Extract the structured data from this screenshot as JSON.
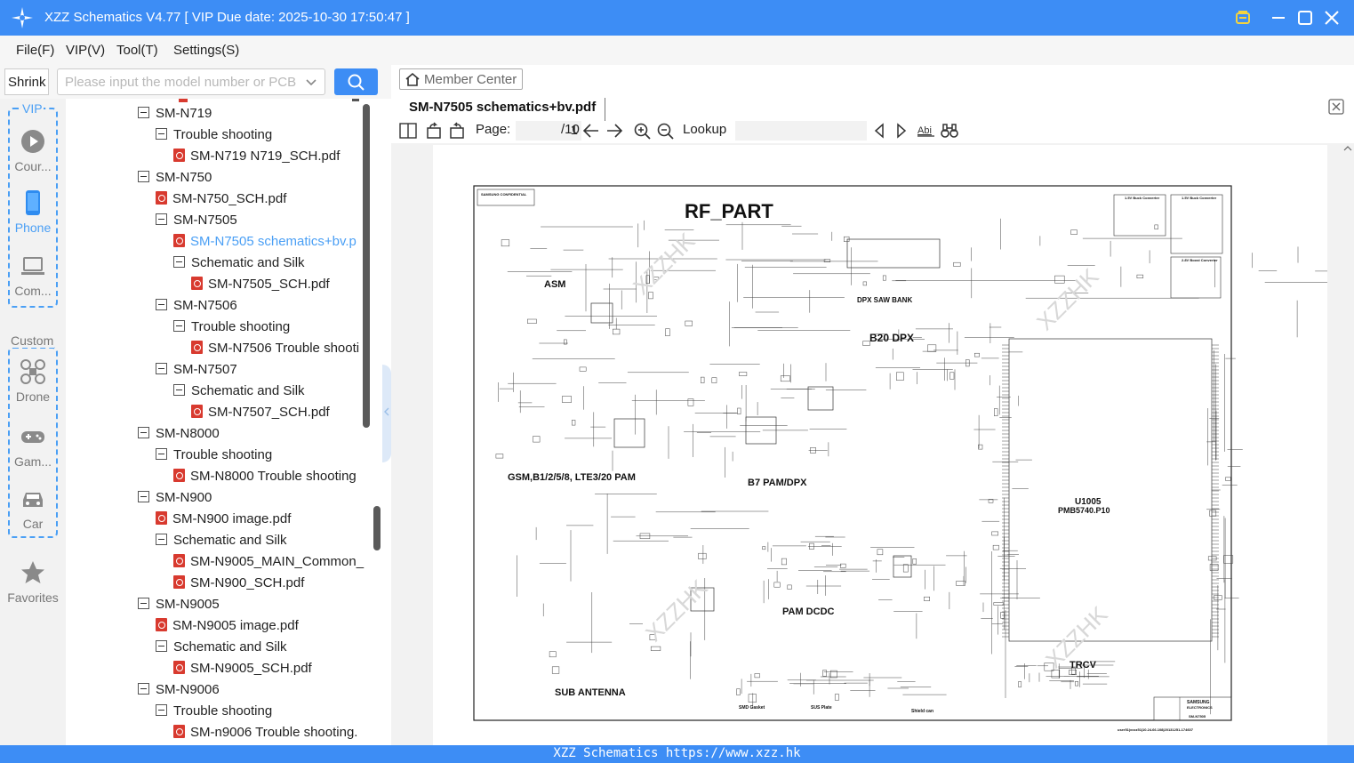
{
  "window": {
    "title": "XZZ Schematics V4.77 [ VIP Due date: 2025-10-30 17:50:47 ]"
  },
  "menu": {
    "file": "File(F)",
    "vip": "VIP(V)",
    "tool": "Tool(T)",
    "settings": "Settings(S)"
  },
  "search": {
    "shrink_label": "Shrink",
    "placeholder": "Please input the model number or PCB"
  },
  "sidebar": {
    "vip_label": "VIP",
    "custom_label": "Custom",
    "favorites_label": "Favorites",
    "items": [
      {
        "label": "Cour...",
        "icon": "play-circle-icon"
      },
      {
        "label": "Phone",
        "icon": "phone-icon",
        "active": true
      },
      {
        "label": "Com...",
        "icon": "laptop-icon"
      },
      {
        "label": "Drone",
        "icon": "drone-icon"
      },
      {
        "label": "Gam...",
        "icon": "gamepad-icon"
      },
      {
        "label": "Car",
        "icon": "car-icon"
      }
    ]
  },
  "tree": [
    {
      "label": "SM-N719",
      "type": "folder",
      "level": 0
    },
    {
      "label": "Trouble shooting",
      "type": "folder",
      "level": 1
    },
    {
      "label": "SM-N719 N719_SCH.pdf",
      "type": "pdf",
      "level": 2
    },
    {
      "label": "SM-N750",
      "type": "folder",
      "level": 0
    },
    {
      "label": "SM-N750_SCH.pdf",
      "type": "pdf",
      "level": 1
    },
    {
      "label": "SM-N7505",
      "type": "folder",
      "level": 1
    },
    {
      "label": "SM-N7505  schematics+bv.p",
      "type": "pdf",
      "level": 2,
      "selected": true
    },
    {
      "label": "Schematic and Silk",
      "type": "folder",
      "level": 2
    },
    {
      "label": "SM-N7505_SCH.pdf",
      "type": "pdf",
      "level": 3
    },
    {
      "label": "SM-N7506",
      "type": "folder",
      "level": 1
    },
    {
      "label": "Trouble shooting",
      "type": "folder",
      "level": 2
    },
    {
      "label": "SM-N7506 Trouble shooti",
      "type": "pdf",
      "level": 3
    },
    {
      "label": "SM-N7507",
      "type": "folder",
      "level": 1
    },
    {
      "label": "Schematic and Silk",
      "type": "folder",
      "level": 2
    },
    {
      "label": "SM-N7507_SCH.pdf",
      "type": "pdf",
      "level": 3
    },
    {
      "label": "SM-N8000",
      "type": "folder",
      "level": 0
    },
    {
      "label": "Trouble shooting",
      "type": "folder",
      "level": 1
    },
    {
      "label": "SM-N8000 Trouble shooting",
      "type": "pdf",
      "level": 2
    },
    {
      "label": "SM-N900",
      "type": "folder",
      "level": 0
    },
    {
      "label": "SM-N900 image.pdf",
      "type": "pdf",
      "level": 1
    },
    {
      "label": "Schematic and Silk",
      "type": "folder",
      "level": 1
    },
    {
      "label": "SM-N9005_MAIN_Common_",
      "type": "pdf",
      "level": 2
    },
    {
      "label": "SM-N900_SCH.pdf",
      "type": "pdf",
      "level": 2
    },
    {
      "label": "SM-N9005",
      "type": "folder",
      "level": 0
    },
    {
      "label": "SM-N9005 image.pdf",
      "type": "pdf",
      "level": 1
    },
    {
      "label": "Schematic and Silk",
      "type": "folder",
      "level": 1
    },
    {
      "label": "SM-N9005_SCH.pdf",
      "type": "pdf",
      "level": 2
    },
    {
      "label": "SM-N9006",
      "type": "folder",
      "level": 0
    },
    {
      "label": "Trouble shooting",
      "type": "folder",
      "level": 1
    },
    {
      "label": "SM-n9006 Trouble shooting.",
      "type": "pdf",
      "level": 2
    }
  ],
  "viewer": {
    "member_center": "Member Center",
    "doc_tab": "SM-N7505  schematics+bv.pdf",
    "page_label": "Page:",
    "page_current": "1",
    "page_total": "/10",
    "lookup_label": "Lookup",
    "lookup_value": ""
  },
  "schematic": {
    "title": "RF_PART",
    "labels": {
      "asm": "ASM",
      "dpx_saw": "DPX SAW BANK",
      "b20": "B20 DPX",
      "gsm": "GSM,B1/2/5/8, LTE3/20 PAM",
      "b7": "B7 PAM/DPX",
      "u1005": "U1005",
      "pmb": "PMB5740.P10",
      "pam_dcdc": "PAM DCDC",
      "trcv": "TRCV",
      "sub_ant": "SUB ANTENNA",
      "smd_gasket": "SMD Gasket",
      "sus_plate": "SUS Plate",
      "shield_can": "Shield can",
      "buck1": "1.5V Buck Converter",
      "buck2": "1.5V Buck Converter",
      "boost": "2.8V Boost Converter",
      "confidential": "SAMSUNG CONFIDENTIAL",
      "samsung": "SAMSUNG",
      "electronics": "ELECTRONICS",
      "model": "SM-N7505",
      "footer": "user51|xxzz51|10.24.66.108|20131251-174607"
    },
    "watermark": "XZZHK"
  },
  "status": {
    "text": "XZZ Schematics https://www.xzz.hk"
  },
  "colors": {
    "accent": "#3d8df5",
    "pdf_red": "#d83a2f",
    "selected": "#4a9ff5"
  }
}
